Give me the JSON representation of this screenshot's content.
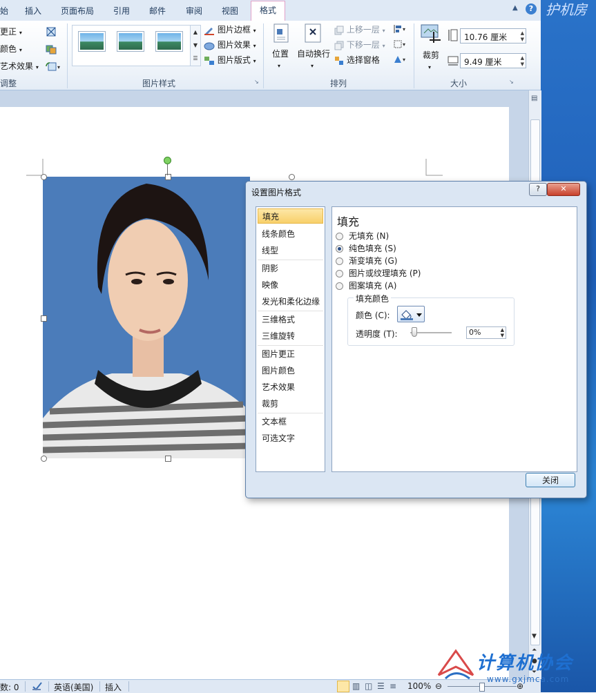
{
  "tabs": [
    "始",
    "插入",
    "页面布局",
    "引用",
    "邮件",
    "审阅",
    "视图",
    "格式"
  ],
  "ribbon": {
    "adjust": {
      "items": [
        "更正",
        "颜色",
        "艺术效果"
      ],
      "label": "调整"
    },
    "styles": {
      "items": [
        "图片边框",
        "图片效果",
        "图片版式"
      ],
      "label": "图片样式"
    },
    "arrange": {
      "position": "位置",
      "wrap": "自动换行",
      "bring_forward": "上移一层",
      "send_backward": "下移一层",
      "selection_pane": "选择窗格",
      "label": "排列"
    },
    "size": {
      "crop": "裁剪",
      "height": "10.76 厘米",
      "width": "9.49 厘米",
      "label": "大小"
    }
  },
  "dialog": {
    "title": "设置图片格式",
    "help_label": "?",
    "close_x": "✕",
    "nav": [
      "填充",
      "线条颜色",
      "线型",
      "阴影",
      "映像",
      "发光和柔化边缘",
      "三维格式",
      "三维旋转",
      "图片更正",
      "图片颜色",
      "艺术效果",
      "裁剪",
      "文本框",
      "可选文字"
    ],
    "panel_title": "填充",
    "options": [
      "无填充 (N)",
      "纯色填充 (S)",
      "渐变填充 (G)",
      "图片或纹理填充 (P)",
      "图案填充 (A)"
    ],
    "selected_option": 1,
    "fill_color_legend": "填充颜色",
    "color_label": "颜色 (C):",
    "transparency_label": "透明度 (T):",
    "transparency_value": "0%",
    "close_button": "关闭"
  },
  "status": {
    "words": "数: 0",
    "language": "英语(美国)",
    "mode": "插入",
    "zoom": "100%"
  },
  "watermark": {
    "text": "计算机协会",
    "url": "www.gxjmca.com"
  }
}
